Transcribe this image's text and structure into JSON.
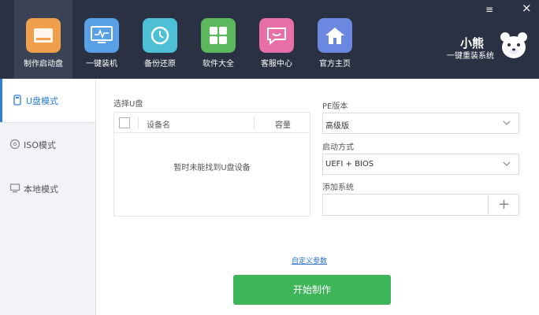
{
  "toolbar": {
    "items": [
      {
        "label": "制作启动盘",
        "icon": "usb-drive-icon",
        "color": "#f0a04b"
      },
      {
        "label": "一键装机",
        "icon": "monitor-icon",
        "color": "#5aa0e8"
      },
      {
        "label": "备份还原",
        "icon": "restore-icon",
        "color": "#4ec0d6"
      },
      {
        "label": "软件大全",
        "icon": "apps-grid-icon",
        "color": "#5cb85c"
      },
      {
        "label": "客服中心",
        "icon": "chat-icon",
        "color": "#e86fa8"
      },
      {
        "label": "官方主页",
        "icon": "home-icon",
        "color": "#6b88e0"
      }
    ]
  },
  "window": {
    "minimize": "≡",
    "close": "×"
  },
  "brand": {
    "title": "小熊",
    "subtitle": "一键重装系统"
  },
  "sidebar": {
    "items": [
      {
        "label": "U盘模式",
        "icon": "usb-icon"
      },
      {
        "label": "ISO模式",
        "icon": "disc-icon"
      },
      {
        "label": "本地模式",
        "icon": "computer-icon"
      }
    ]
  },
  "usb_panel": {
    "label": "选择U盘",
    "columns": [
      "设备名",
      "容量"
    ],
    "empty_message": "暂时未能找到U盘设备"
  },
  "pe_version": {
    "label": "PE版本",
    "value": "高级版"
  },
  "boot_mode": {
    "label": "启动方式",
    "value": "UEFI + BIOS"
  },
  "add_system": {
    "label": "添加系统",
    "value": "",
    "plus": "+"
  },
  "custom_params_link": "自定义参数",
  "start_button": "开始制作",
  "colors": {
    "header_bg": "#2a3142",
    "accent": "#2c80d8",
    "start_green": "#3fb55a"
  }
}
